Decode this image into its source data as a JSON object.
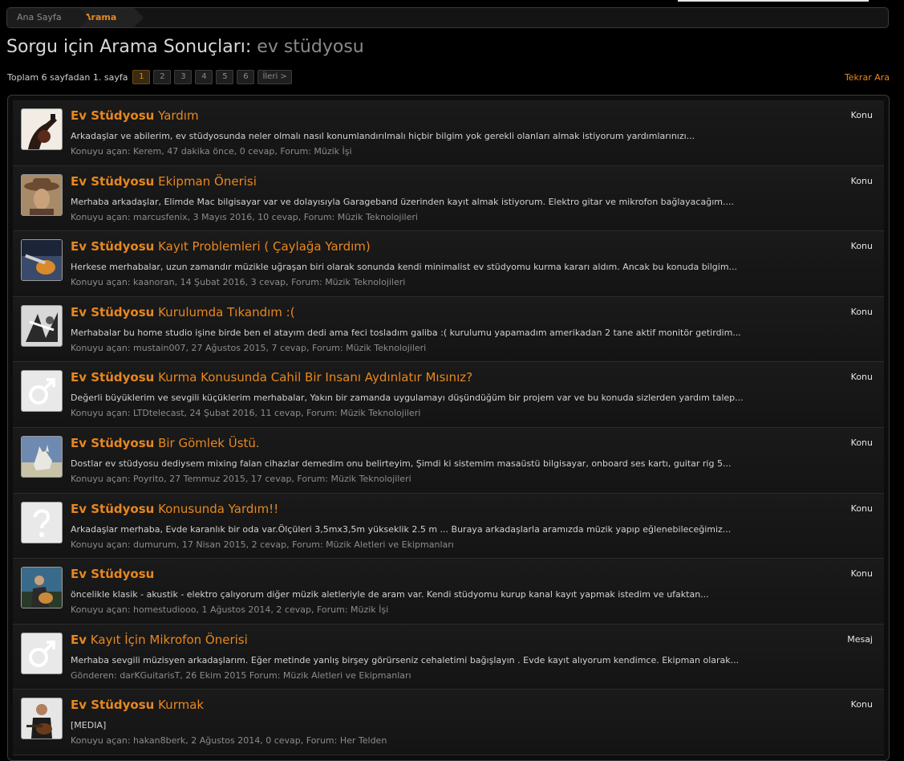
{
  "breadcrumb": {
    "home": "Ana Sayfa",
    "current": "Arama"
  },
  "page_title": {
    "prefix": "Sorgu için Arama Sonuçları:",
    "query": "ev stüdyosu"
  },
  "pager": {
    "label": "Toplam 6 sayfadan 1. sayfa",
    "pages": [
      "1",
      "2",
      "3",
      "4",
      "5",
      "6"
    ],
    "active": "1",
    "next": "İleri >"
  },
  "search_again": "Tekrar Ara",
  "results": [
    {
      "title_bold": "Ev Stüdyosu",
      "title_rest": " Yardım",
      "kind": "Konu",
      "snippet": "Arkadaşlar ve abilerim, ev stüdyosunda neler olmalı nasıl konumlandırılmalı hiçbir bilgim yok gerekli olanları almak istiyorum yardımlarınızı...",
      "meta": "Konuyu açan: Kerem, 47 dakika önce, 0 cevap, Forum: Müzik İşi",
      "avatar": "guitar-photo"
    },
    {
      "title_bold": "Ev Stüdyosu",
      "title_rest": " Ekipman Önerisi",
      "kind": "Konu",
      "snippet": "Merhaba arkadaşlar, Elimde Mac bilgisayar var ve dolayısıyla Garageband üzerinden kayıt almak istiyorum. Elektro gitar ve mikrofon bağlayacağım....",
      "meta": "Konuyu açan: marcusfenix, 3 Mayıs 2016, 10 cevap, Forum: Müzik Teknolojileri",
      "avatar": "cowboy-photo"
    },
    {
      "title_bold": "Ev Stüdyosu",
      "title_rest": " Kayıt Problemleri ( Çaylağa Yardım)",
      "kind": "Konu",
      "snippet": "Herkese merhabalar, uzun zamandır müzikle uğraşan biri olarak sonunda kendi minimalist ev stüdyomu kurma kararı aldım. Ancak bu konuda bilgim...",
      "meta": "Konuyu açan: kaanoran, 14 Şubat 2016, 3 cevap, Forum: Müzik Teknolojileri",
      "avatar": "guitar-blue-photo"
    },
    {
      "title_bold": "Ev Stüdyosu",
      "title_rest": " Kurulumda Tıkandım :(",
      "kind": "Konu",
      "snippet": "Merhabalar bu home studio işine birde ben el atayım dedi ama feci tosladım galiba :( kurulumu yapamadım amerikadan 2 tane aktif monitör getirdim...",
      "meta": "Konuyu açan: mustain007, 27 Ağustos 2015, 7 cevap, Forum: Müzik Teknolojileri",
      "avatar": "bw-photo"
    },
    {
      "title_bold": "Ev Stüdyosu",
      "title_rest": " Kurma Konusunda Cahil Bir Insanı Aydınlatır Mısınız?",
      "kind": "Konu",
      "snippet": "Değerli büyüklerim ve sevgili küçüklerim merhabalar, Yakın bir zamanda uygulamayı düşündüğüm bir projem var ve bu konuda sizlerden yardım talep...",
      "meta": "Konuyu açan: LTDtelecast, 24 Şubat 2016, 11 cevap, Forum: Müzik Teknolojileri",
      "avatar": "male-symbol"
    },
    {
      "title_bold": "Ev Stüdyosu",
      "title_rest": " Bir Gömlek Üstü.",
      "kind": "Konu",
      "snippet": "Dostlar ev stüdyosu dediysem mixing falan cihazlar demedim onu belirteyim, Şimdi ki sistemim masaüstü bilgisayar, onboard ses kartı, guitar rig 5...",
      "meta": "Konuyu açan: Poyrito, 27 Temmuz 2015, 17 cevap, Forum: Müzik Teknolojileri",
      "avatar": "cat-photo"
    },
    {
      "title_bold": "Ev Stüdyosu",
      "title_rest": " Konusunda Yardım!!",
      "kind": "Konu",
      "snippet": "Arkadaşlar merhaba, Evde karanlık bir oda var.Ölçüleri 3,5mx3,5m yükseklik 2.5 m ... Buraya arkadaşlarla aramızda müzik yapıp eğlenebileceğimiz...",
      "meta": "Konuyu açan: dumurum, 17 Nisan 2015, 2 cevap, Forum: Müzik Aletleri ve Ekipmanları",
      "avatar": "question-mark"
    },
    {
      "title_bold": "Ev Stüdyosu",
      "title_rest": "",
      "kind": "Konu",
      "snippet": "öncelikle klasik - akustik - elektro çalıyorum diğer müzik aletleriyle de aram var. Kendi stüdyomu kurup kanal kayıt yapmak istedim ve ufaktan...",
      "meta": "Konuyu açan: homestudiooo, 1 Ağustos 2014, 2 cevap, Forum: Müzik İşi",
      "avatar": "player-photo"
    },
    {
      "title_bold": "Ev",
      "title_rest": " Kayıt İçin Mikrofon Önerisi",
      "kind": "Mesaj",
      "snippet": "Merhaba sevgili müzisyen arkadaşlarım. Eğer metinde yanlış birşey görürseniz cehaletimi bağışlayın . Evde kayıt alıyorum kendimce. Ekipman olarak...",
      "meta": "Gönderen: darKGuitarisT, 26 Ekim 2015 Forum: Müzik Aletleri ve Ekipmanları",
      "avatar": "male-symbol"
    },
    {
      "title_bold": "Ev Stüdyosu",
      "title_rest": " Kurmak",
      "kind": "Konu",
      "snippet": "[MEDIA]",
      "meta": "Konuyu açan: hakan8berk, 2 Ağustos 2014, 0 cevap, Forum: Her Telden",
      "avatar": "guitarist-photo"
    }
  ]
}
